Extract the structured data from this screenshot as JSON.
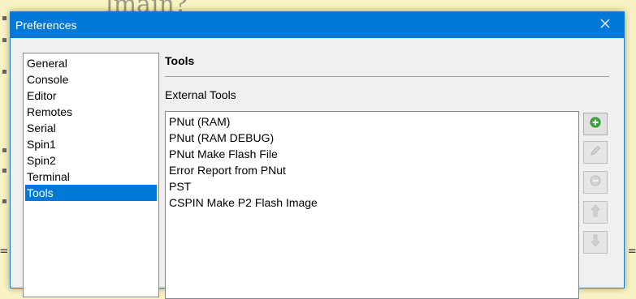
{
  "background": {
    "heading_fragment": "lmain?",
    "eq_left": "=",
    "eq_right": "="
  },
  "dialog": {
    "title": "Preferences",
    "close_icon": "close-icon"
  },
  "categories": [
    {
      "label": "General",
      "selected": false
    },
    {
      "label": "Console",
      "selected": false
    },
    {
      "label": "Editor",
      "selected": false
    },
    {
      "label": "Remotes",
      "selected": false
    },
    {
      "label": "Serial",
      "selected": false
    },
    {
      "label": "Spin1",
      "selected": false
    },
    {
      "label": "Spin2",
      "selected": false
    },
    {
      "label": "Terminal",
      "selected": false
    },
    {
      "label": "Tools",
      "selected": true
    }
  ],
  "panel": {
    "title": "Tools",
    "group_label": "External Tools",
    "tools": [
      "PNut (RAM)",
      "PNut (RAM DEBUG)",
      "PNut Make Flash File",
      "Error Report from PNut",
      "PST",
      "CSPIN Make P2 Flash Image"
    ]
  },
  "side_buttons": [
    {
      "icon": "add-icon",
      "enabled": true
    },
    {
      "icon": "edit-icon",
      "enabled": false
    },
    {
      "icon": "remove-icon",
      "enabled": false
    },
    {
      "icon": "move-up-icon",
      "enabled": false
    },
    {
      "icon": "move-down-icon",
      "enabled": false
    }
  ],
  "colors": {
    "accent": "#0078d7",
    "add_green": "#3aa83a"
  }
}
